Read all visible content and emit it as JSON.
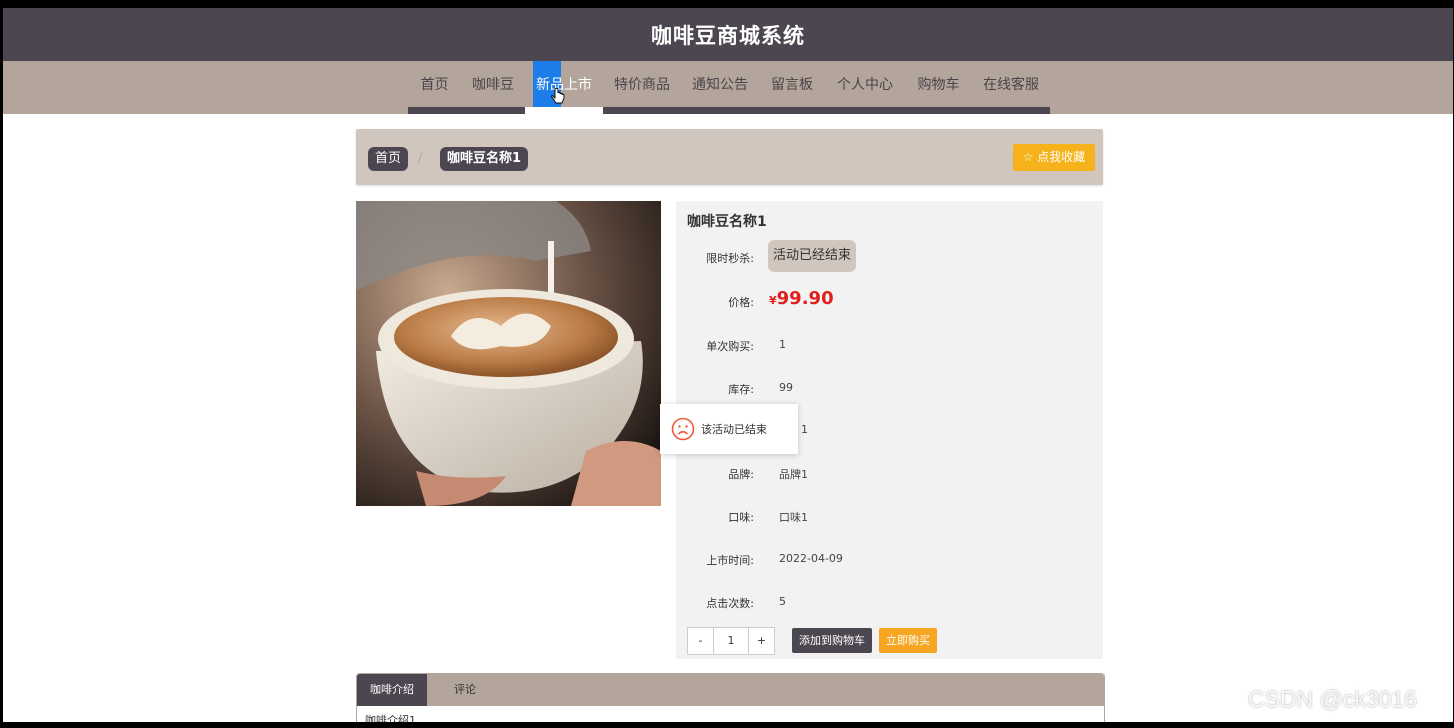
{
  "header": {
    "title": "咖啡豆商城系统"
  },
  "nav": {
    "items": [
      "首页",
      "咖啡豆",
      "新品上市",
      "特价商品",
      "通知公告",
      "留言板",
      "个人中心",
      "购物车",
      "在线客服"
    ],
    "active_index": 2
  },
  "breadcrumb": {
    "home": "首页",
    "current": "咖啡豆名称1",
    "favorite_label": "☆ 点我收藏"
  },
  "product": {
    "name": "咖啡豆名称1",
    "image_alt": "latte art coffee",
    "flash_sale_label": "限时秒杀:",
    "flash_sale_status": "活动已经结束",
    "price_label": "价格:",
    "currency": "¥",
    "price": "99.90",
    "rows": [
      {
        "label": "单次购买:",
        "value": "1"
      },
      {
        "label": "库存:",
        "value": "99"
      },
      {
        "label": "",
        "value": "1"
      },
      {
        "label": "品牌:",
        "value": "品牌1"
      },
      {
        "label": "口味:",
        "value": "口味1"
      },
      {
        "label": "上市时间:",
        "value": "2022-04-09"
      },
      {
        "label": "点击次数:",
        "value": "5"
      }
    ],
    "quantity": "1",
    "minus": "-",
    "plus": "+",
    "add_to_cart": "添加到购物车",
    "buy_now": "立即购买"
  },
  "toast": {
    "message": "该活动已结束"
  },
  "tabs": {
    "items": [
      "咖啡介绍",
      "评论"
    ],
    "content": "咖啡介绍1"
  },
  "watermark": "CSDN @ck3016",
  "colors": {
    "header_bg": "#4c4650",
    "nav_bg": "#b4a59c",
    "active_nav": "#1c7de8",
    "price_red": "#e0201c",
    "favorite_orange": "#f6b21b",
    "buy_orange": "#f6a623"
  }
}
